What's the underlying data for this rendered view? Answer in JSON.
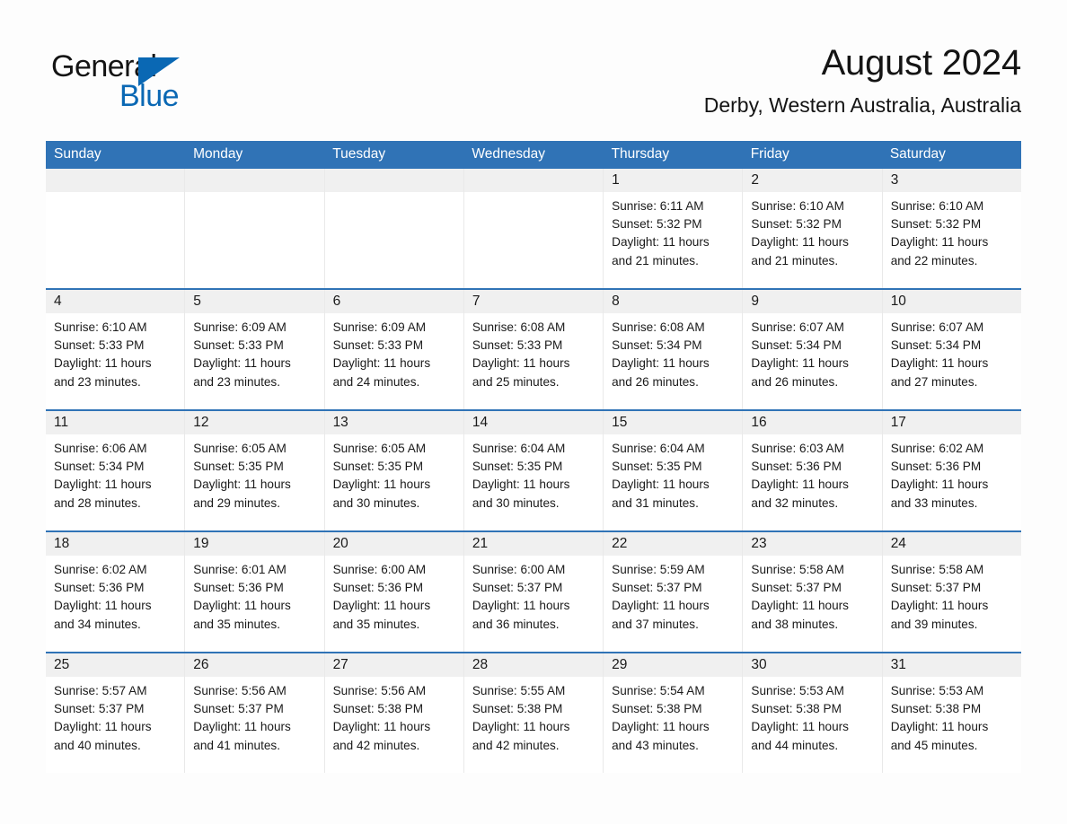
{
  "brand": {
    "name_part1": "General",
    "name_part2": "Blue",
    "triangle_color": "#0a68b4"
  },
  "header": {
    "title": "August 2024",
    "location": "Derby, Western Australia, Australia",
    "accent_color": "#3073b6"
  },
  "weekdays": [
    "Sunday",
    "Monday",
    "Tuesday",
    "Wednesday",
    "Thursday",
    "Friday",
    "Saturday"
  ],
  "weeks": [
    [
      {
        "day": "",
        "sunrise": "",
        "sunset": "",
        "daylight_line1": "",
        "daylight_line2": "",
        "empty": true
      },
      {
        "day": "",
        "sunrise": "",
        "sunset": "",
        "daylight_line1": "",
        "daylight_line2": "",
        "empty": true
      },
      {
        "day": "",
        "sunrise": "",
        "sunset": "",
        "daylight_line1": "",
        "daylight_line2": "",
        "empty": true
      },
      {
        "day": "",
        "sunrise": "",
        "sunset": "",
        "daylight_line1": "",
        "daylight_line2": "",
        "empty": true
      },
      {
        "day": "1",
        "sunrise": "Sunrise: 6:11 AM",
        "sunset": "Sunset: 5:32 PM",
        "daylight_line1": "Daylight: 11 hours",
        "daylight_line2": "and 21 minutes."
      },
      {
        "day": "2",
        "sunrise": "Sunrise: 6:10 AM",
        "sunset": "Sunset: 5:32 PM",
        "daylight_line1": "Daylight: 11 hours",
        "daylight_line2": "and 21 minutes."
      },
      {
        "day": "3",
        "sunrise": "Sunrise: 6:10 AM",
        "sunset": "Sunset: 5:32 PM",
        "daylight_line1": "Daylight: 11 hours",
        "daylight_line2": "and 22 minutes."
      }
    ],
    [
      {
        "day": "4",
        "sunrise": "Sunrise: 6:10 AM",
        "sunset": "Sunset: 5:33 PM",
        "daylight_line1": "Daylight: 11 hours",
        "daylight_line2": "and 23 minutes."
      },
      {
        "day": "5",
        "sunrise": "Sunrise: 6:09 AM",
        "sunset": "Sunset: 5:33 PM",
        "daylight_line1": "Daylight: 11 hours",
        "daylight_line2": "and 23 minutes."
      },
      {
        "day": "6",
        "sunrise": "Sunrise: 6:09 AM",
        "sunset": "Sunset: 5:33 PM",
        "daylight_line1": "Daylight: 11 hours",
        "daylight_line2": "and 24 minutes."
      },
      {
        "day": "7",
        "sunrise": "Sunrise: 6:08 AM",
        "sunset": "Sunset: 5:33 PM",
        "daylight_line1": "Daylight: 11 hours",
        "daylight_line2": "and 25 minutes."
      },
      {
        "day": "8",
        "sunrise": "Sunrise: 6:08 AM",
        "sunset": "Sunset: 5:34 PM",
        "daylight_line1": "Daylight: 11 hours",
        "daylight_line2": "and 26 minutes."
      },
      {
        "day": "9",
        "sunrise": "Sunrise: 6:07 AM",
        "sunset": "Sunset: 5:34 PM",
        "daylight_line1": "Daylight: 11 hours",
        "daylight_line2": "and 26 minutes."
      },
      {
        "day": "10",
        "sunrise": "Sunrise: 6:07 AM",
        "sunset": "Sunset: 5:34 PM",
        "daylight_line1": "Daylight: 11 hours",
        "daylight_line2": "and 27 minutes."
      }
    ],
    [
      {
        "day": "11",
        "sunrise": "Sunrise: 6:06 AM",
        "sunset": "Sunset: 5:34 PM",
        "daylight_line1": "Daylight: 11 hours",
        "daylight_line2": "and 28 minutes."
      },
      {
        "day": "12",
        "sunrise": "Sunrise: 6:05 AM",
        "sunset": "Sunset: 5:35 PM",
        "daylight_line1": "Daylight: 11 hours",
        "daylight_line2": "and 29 minutes."
      },
      {
        "day": "13",
        "sunrise": "Sunrise: 6:05 AM",
        "sunset": "Sunset: 5:35 PM",
        "daylight_line1": "Daylight: 11 hours",
        "daylight_line2": "and 30 minutes."
      },
      {
        "day": "14",
        "sunrise": "Sunrise: 6:04 AM",
        "sunset": "Sunset: 5:35 PM",
        "daylight_line1": "Daylight: 11 hours",
        "daylight_line2": "and 30 minutes."
      },
      {
        "day": "15",
        "sunrise": "Sunrise: 6:04 AM",
        "sunset": "Sunset: 5:35 PM",
        "daylight_line1": "Daylight: 11 hours",
        "daylight_line2": "and 31 minutes."
      },
      {
        "day": "16",
        "sunrise": "Sunrise: 6:03 AM",
        "sunset": "Sunset: 5:36 PM",
        "daylight_line1": "Daylight: 11 hours",
        "daylight_line2": "and 32 minutes."
      },
      {
        "day": "17",
        "sunrise": "Sunrise: 6:02 AM",
        "sunset": "Sunset: 5:36 PM",
        "daylight_line1": "Daylight: 11 hours",
        "daylight_line2": "and 33 minutes."
      }
    ],
    [
      {
        "day": "18",
        "sunrise": "Sunrise: 6:02 AM",
        "sunset": "Sunset: 5:36 PM",
        "daylight_line1": "Daylight: 11 hours",
        "daylight_line2": "and 34 minutes."
      },
      {
        "day": "19",
        "sunrise": "Sunrise: 6:01 AM",
        "sunset": "Sunset: 5:36 PM",
        "daylight_line1": "Daylight: 11 hours",
        "daylight_line2": "and 35 minutes."
      },
      {
        "day": "20",
        "sunrise": "Sunrise: 6:00 AM",
        "sunset": "Sunset: 5:36 PM",
        "daylight_line1": "Daylight: 11 hours",
        "daylight_line2": "and 35 minutes."
      },
      {
        "day": "21",
        "sunrise": "Sunrise: 6:00 AM",
        "sunset": "Sunset: 5:37 PM",
        "daylight_line1": "Daylight: 11 hours",
        "daylight_line2": "and 36 minutes."
      },
      {
        "day": "22",
        "sunrise": "Sunrise: 5:59 AM",
        "sunset": "Sunset: 5:37 PM",
        "daylight_line1": "Daylight: 11 hours",
        "daylight_line2": "and 37 minutes."
      },
      {
        "day": "23",
        "sunrise": "Sunrise: 5:58 AM",
        "sunset": "Sunset: 5:37 PM",
        "daylight_line1": "Daylight: 11 hours",
        "daylight_line2": "and 38 minutes."
      },
      {
        "day": "24",
        "sunrise": "Sunrise: 5:58 AM",
        "sunset": "Sunset: 5:37 PM",
        "daylight_line1": "Daylight: 11 hours",
        "daylight_line2": "and 39 minutes."
      }
    ],
    [
      {
        "day": "25",
        "sunrise": "Sunrise: 5:57 AM",
        "sunset": "Sunset: 5:37 PM",
        "daylight_line1": "Daylight: 11 hours",
        "daylight_line2": "and 40 minutes."
      },
      {
        "day": "26",
        "sunrise": "Sunrise: 5:56 AM",
        "sunset": "Sunset: 5:37 PM",
        "daylight_line1": "Daylight: 11 hours",
        "daylight_line2": "and 41 minutes."
      },
      {
        "day": "27",
        "sunrise": "Sunrise: 5:56 AM",
        "sunset": "Sunset: 5:38 PM",
        "daylight_line1": "Daylight: 11 hours",
        "daylight_line2": "and 42 minutes."
      },
      {
        "day": "28",
        "sunrise": "Sunrise: 5:55 AM",
        "sunset": "Sunset: 5:38 PM",
        "daylight_line1": "Daylight: 11 hours",
        "daylight_line2": "and 42 minutes."
      },
      {
        "day": "29",
        "sunrise": "Sunrise: 5:54 AM",
        "sunset": "Sunset: 5:38 PM",
        "daylight_line1": "Daylight: 11 hours",
        "daylight_line2": "and 43 minutes."
      },
      {
        "day": "30",
        "sunrise": "Sunrise: 5:53 AM",
        "sunset": "Sunset: 5:38 PM",
        "daylight_line1": "Daylight: 11 hours",
        "daylight_line2": "and 44 minutes."
      },
      {
        "day": "31",
        "sunrise": "Sunrise: 5:53 AM",
        "sunset": "Sunset: 5:38 PM",
        "daylight_line1": "Daylight: 11 hours",
        "daylight_line2": "and 45 minutes."
      }
    ]
  ]
}
